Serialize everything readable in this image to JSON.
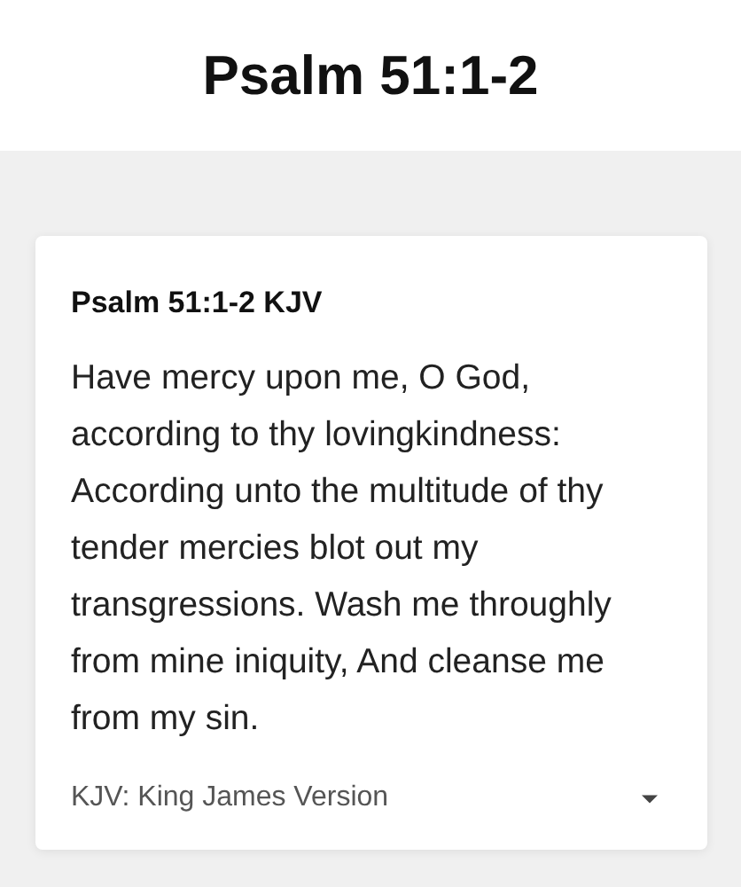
{
  "page_title": "Psalm 51:1-2",
  "card": {
    "reference": "Psalm 51:1-2 KJV",
    "verse_text": "Have mercy upon me, O God, according to thy lovingkindness: According unto the multitude of thy tender mercies blot out my transgressions. Wash me throughly from mine iniquity, And cleanse me from my sin.",
    "version_select": {
      "value": "KJV: King James Version"
    }
  }
}
